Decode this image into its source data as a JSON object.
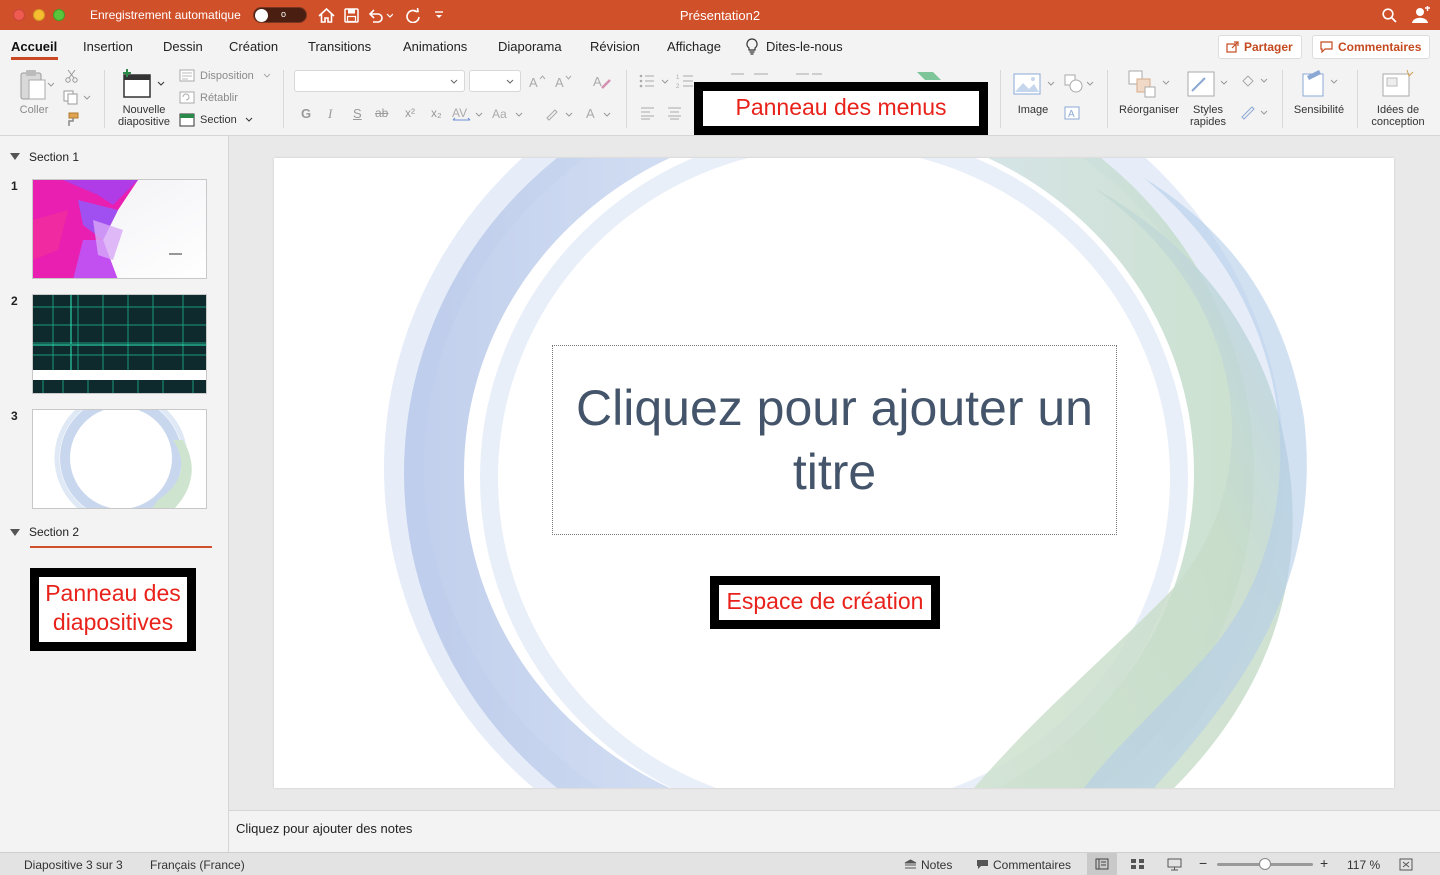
{
  "titlebar": {
    "autosave_label": "Enregistrement automatique",
    "autosave_state": "o",
    "document_title": "Présentation2"
  },
  "tabs": [
    {
      "label": "Accueil",
      "active": true
    },
    {
      "label": "Insertion"
    },
    {
      "label": "Dessin"
    },
    {
      "label": "Création"
    },
    {
      "label": "Transitions"
    },
    {
      "label": "Animations"
    },
    {
      "label": "Diaporama"
    },
    {
      "label": "Révision"
    },
    {
      "label": "Affichage"
    },
    {
      "label": "Dites-le-nous"
    }
  ],
  "header_buttons": {
    "share": "Partager",
    "comments": "Commentaires"
  },
  "ribbon": {
    "paste": "Coller",
    "new_slide_l1": "Nouvelle",
    "new_slide_l2": "diapositive",
    "layout": "Disposition",
    "reset": "Rétablir",
    "section": "Section",
    "font_buttons": [
      "G",
      "I",
      "S",
      "ab",
      "x²",
      "x₂"
    ],
    "image": "Image",
    "arrange": "Réorganiser",
    "quick_styles_l1": "Styles",
    "quick_styles_l2": "rapides",
    "sensitivity": "Sensibilité",
    "design_ideas_l1": "Idées de",
    "design_ideas_l2": "conception"
  },
  "slides_pane": {
    "section1": "Section 1",
    "section2": "Section 2",
    "slides": [
      {
        "num": "1"
      },
      {
        "num": "2"
      },
      {
        "num": "3"
      }
    ]
  },
  "slide": {
    "title_placeholder": "Cliquez pour ajouter un titre"
  },
  "annotations": {
    "menus": "Panneau des menus",
    "design_space": "Espace de création",
    "slides_panel": "Panneau des diapositives"
  },
  "notes": {
    "placeholder": "Cliquez pour ajouter des notes"
  },
  "statusbar": {
    "slide_counter": "Diapositive 3 sur 3",
    "language": "Français (France)",
    "notes": "Notes",
    "comments": "Commentaires",
    "zoom": "117 %",
    "zoom_level": 0.5
  },
  "colors": {
    "accent": "#d0502a",
    "title_text": "#44546a",
    "annotation_text": "#e8221b"
  }
}
